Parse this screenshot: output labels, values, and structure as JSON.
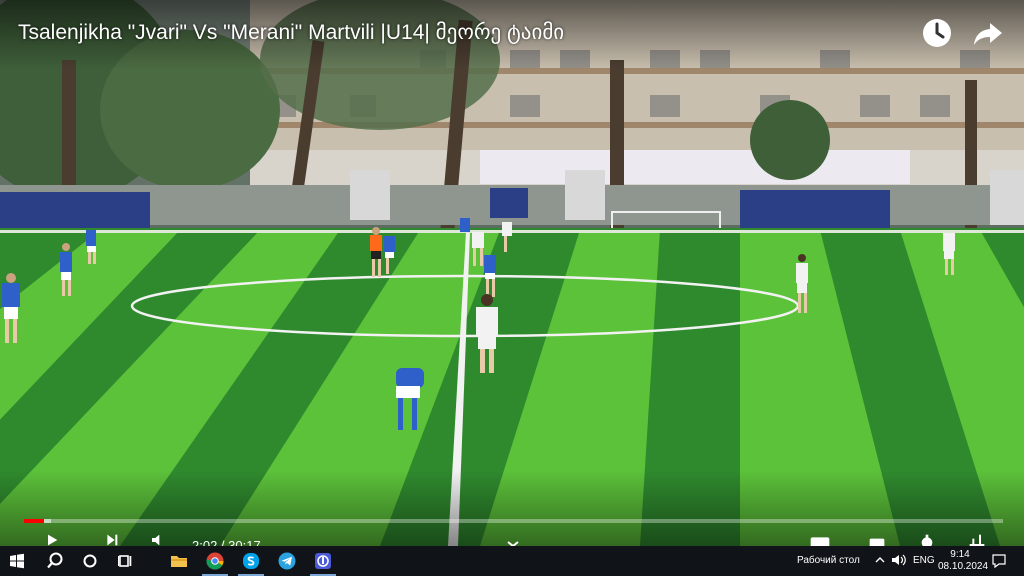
{
  "video": {
    "title": "Tsalenjikha \"Jvari\" Vs \"Merani\" Martvili |U14| მეორე ტაიმი",
    "time_display": "2:02 / 30:17",
    "progress_fraction": 0.02,
    "loaded_fraction": 0.028
  },
  "overlay_icons": {
    "watch_later": "clock-icon",
    "share": "share-arrow-icon"
  },
  "player_controls": [
    "play-icon",
    "next-icon",
    "volume-icon",
    "subtitles-icon",
    "settings-icon",
    "fullscreen-icon"
  ],
  "taskbar": {
    "apps": [
      "windows-start-icon",
      "search-icon",
      "cortana-icon",
      "task-view-icon",
      "file-explorer-icon",
      "chrome-icon",
      "skype-icon",
      "telegram-icon",
      "app-icon"
    ],
    "desktop_label": "Рабочий стол",
    "language": "ENG",
    "time": "9:14",
    "date": "08.10.2024",
    "colors": {
      "background": "#101418",
      "accent": "#7aa7d6"
    }
  },
  "colors": {
    "progress_played": "#ff0000",
    "pitch_dark": "#2f8a2e",
    "pitch_light": "#5cc23a",
    "team_blue": "#2f5fc8",
    "team_white": "#f2f2f2"
  }
}
